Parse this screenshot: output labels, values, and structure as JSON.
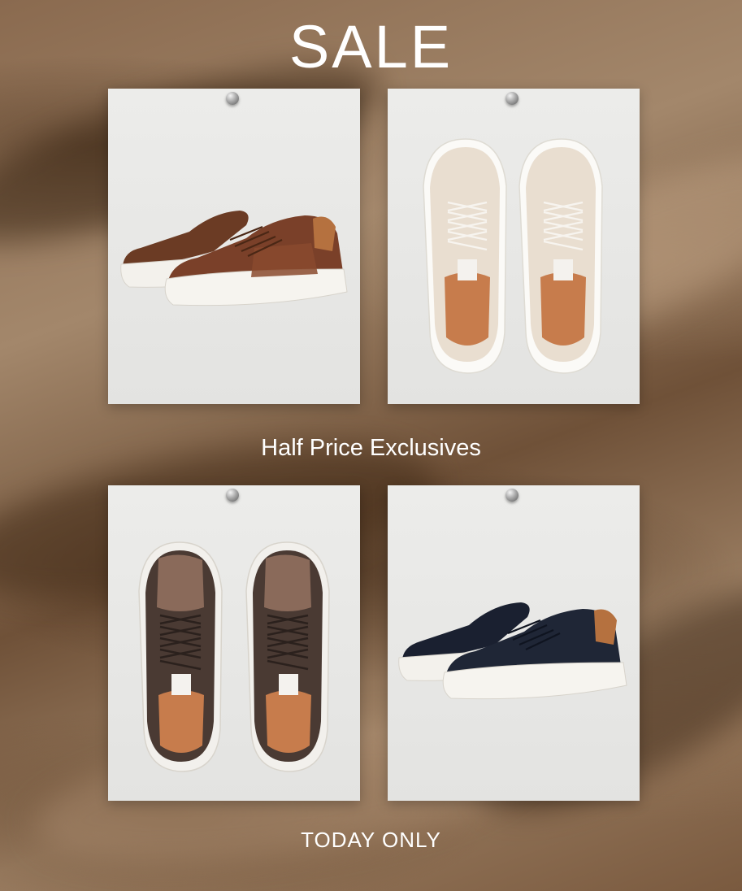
{
  "banner": {
    "title": "SALE",
    "subtitle": "Half Price Exclusives",
    "footer": "TODAY ONLY"
  },
  "products": [
    {
      "icon": "brown-sneaker-side-view-icon",
      "color": "#7a4029"
    },
    {
      "icon": "cream-sneaker-top-view-icon",
      "color": "#e8dccb"
    },
    {
      "icon": "dark-brown-sneaker-top-view-icon",
      "color": "#4a3a33"
    },
    {
      "icon": "navy-sneaker-side-view-icon",
      "color": "#1f2636"
    }
  ],
  "colors": {
    "text": "#ffffff",
    "card": "#e8e8e6",
    "background": "#8a6a4f"
  }
}
